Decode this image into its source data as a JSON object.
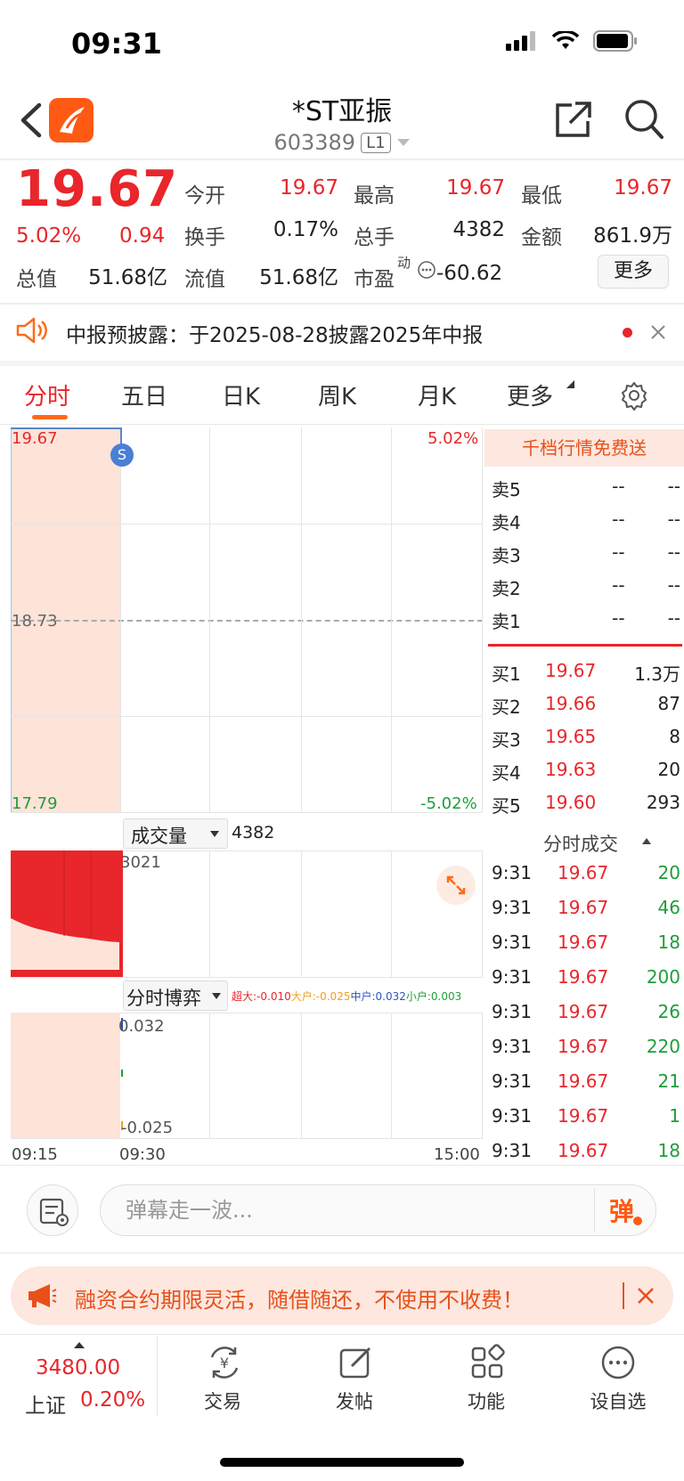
{
  "status_bar": {
    "time": "09:31"
  },
  "header": {
    "stock_name": "*ST亚振",
    "stock_code": "603389",
    "level": "L1"
  },
  "quote": {
    "price": "19.67",
    "change_pct": "5.02%",
    "change_amt": "0.94",
    "open_label": "今开",
    "open": "19.67",
    "high_label": "最高",
    "high": "19.67",
    "low_label": "最低",
    "low": "19.67",
    "turnover_label": "换手",
    "turnover": "0.17%",
    "volume_label": "总手",
    "volume": "4382",
    "amount_label": "金额",
    "amount": "861.9万",
    "mktcap_label": "总值",
    "mktcap": "51.68亿",
    "float_label": "流值",
    "float": "51.68亿",
    "pe_label": "市盈",
    "pe_sup": "动",
    "pe": "-60.62",
    "more_button": "更多"
  },
  "notice": {
    "text": "中报预披露：于2025-08-28披露2025年中报"
  },
  "tabs": [
    "分时",
    "五日",
    "日K",
    "周K",
    "月K",
    "更多"
  ],
  "chart": {
    "price_top": "19.67",
    "pct_top": "5.02%",
    "price_mid": "18.73",
    "price_bottom": "17.79",
    "pct_bottom": "-5.02%",
    "s_marker": "S",
    "volume_selector": "成交量",
    "volume_total": "4382",
    "volume_max": "3021",
    "game_selector": "分时博弈",
    "game_legend": [
      {
        "label": "超大:",
        "value": "-0.010",
        "color": "#e8262b"
      },
      {
        "label": "大户:",
        "value": "-0.025",
        "color": "#f0a020"
      },
      {
        "label": "中户:",
        "value": "0.032",
        "color": "#2b54c6"
      },
      {
        "label": "小户:",
        "value": "0.003",
        "color": "#1e9e3a"
      }
    ],
    "game_top": "0.032",
    "game_bottom": "-0.025",
    "time_start": "09:15",
    "time_open": "09:30",
    "time_end": "15:00"
  },
  "order_book": {
    "banner": "千档行情免费送",
    "sells": [
      {
        "label": "卖5",
        "price": "--",
        "vol": "--"
      },
      {
        "label": "卖4",
        "price": "--",
        "vol": "--"
      },
      {
        "label": "卖3",
        "price": "--",
        "vol": "--"
      },
      {
        "label": "卖2",
        "price": "--",
        "vol": "--"
      },
      {
        "label": "卖1",
        "price": "--",
        "vol": "--"
      }
    ],
    "buys": [
      {
        "label": "买1",
        "price": "19.67",
        "vol": "1.3万"
      },
      {
        "label": "买2",
        "price": "19.66",
        "vol": "87"
      },
      {
        "label": "买3",
        "price": "19.65",
        "vol": "8"
      },
      {
        "label": "买4",
        "price": "19.63",
        "vol": "20"
      },
      {
        "label": "买5",
        "price": "19.60",
        "vol": "293"
      }
    ],
    "ticks_header": "分时成交",
    "ticks": [
      {
        "time": "9:31",
        "price": "19.67",
        "vol": "20"
      },
      {
        "time": "9:31",
        "price": "19.67",
        "vol": "46"
      },
      {
        "time": "9:31",
        "price": "19.67",
        "vol": "18"
      },
      {
        "time": "9:31",
        "price": "19.67",
        "vol": "200"
      },
      {
        "time": "9:31",
        "price": "19.67",
        "vol": "26"
      },
      {
        "time": "9:31",
        "price": "19.67",
        "vol": "220"
      },
      {
        "time": "9:31",
        "price": "19.67",
        "vol": "21"
      },
      {
        "time": "9:31",
        "price": "19.67",
        "vol": "1"
      },
      {
        "time": "9:31",
        "price": "19.67",
        "vol": "18"
      }
    ]
  },
  "comment_bar": {
    "placeholder": "弹幕走一波...",
    "danmu_button": "弹"
  },
  "promo": {
    "text": "融资合约期限灵活，随借随还，不使用不收费！"
  },
  "bottom_nav": {
    "index_value": "3480.00",
    "index_name": "上证",
    "index_pct": "0.20%",
    "items": [
      "交易",
      "发帖",
      "功能",
      "设自选"
    ]
  },
  "colors": {
    "up": "#e8262b",
    "down": "#1e9e3a",
    "accent": "#ff6a1a"
  }
}
